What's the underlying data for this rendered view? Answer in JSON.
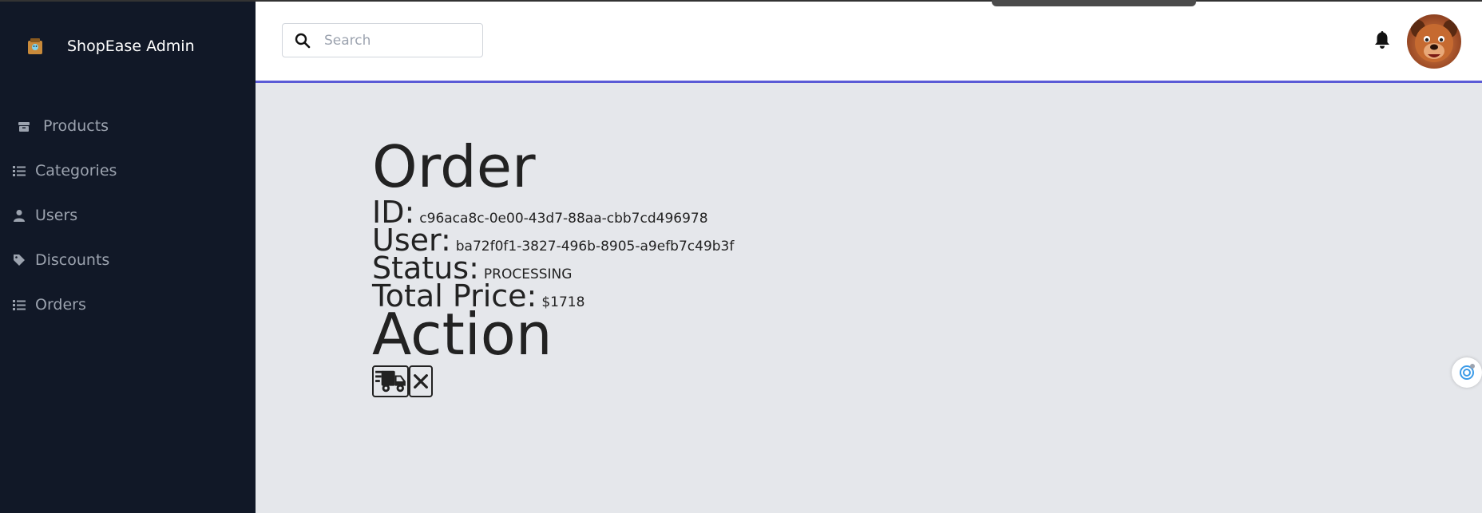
{
  "app": {
    "brand": "ShopEase Admin"
  },
  "sidebar": {
    "items": [
      {
        "label": "Products",
        "icon": "box-icon"
      },
      {
        "label": "Categories",
        "icon": "list-icon"
      },
      {
        "label": "Users",
        "icon": "user-icon"
      },
      {
        "label": "Discounts",
        "icon": "tag-icon"
      },
      {
        "label": "Orders",
        "icon": "list-icon"
      }
    ]
  },
  "header": {
    "search": {
      "placeholder": "Search",
      "value": ""
    },
    "accent_color": "#5b5bd6"
  },
  "order": {
    "heading": "Order",
    "id_label": "ID:",
    "id_value": "c96aca8c-0e00-43d7-88aa-cbb7cd496978",
    "user_label": "User:",
    "user_value": "ba72f0f1-3827-496b-8905-a9efb7c49b3f",
    "status_label": "Status:",
    "status_value": "PROCESSING",
    "total_label": "Total Price:",
    "total_value": "$1718",
    "action_heading": "Action"
  },
  "actions": [
    {
      "name": "ship",
      "icon": "truck-icon"
    },
    {
      "name": "cancel",
      "icon": "close-icon"
    }
  ],
  "colors": {
    "sidebar_bg": "#111827",
    "content_bg": "#e5e7eb"
  }
}
